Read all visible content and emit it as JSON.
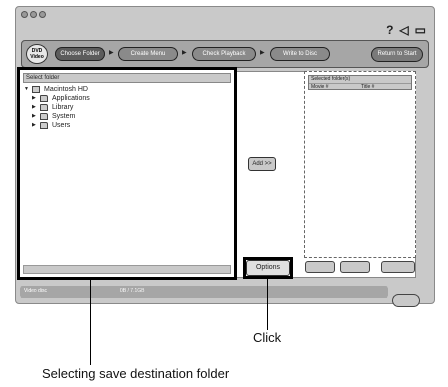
{
  "toolbar": {
    "logo_top": "DVD",
    "logo_bottom": "Video",
    "steps": [
      "Choose Folder",
      "Create Menu",
      "Check Playback",
      "Write to Disc"
    ],
    "return_label": "Return to Start"
  },
  "help_icon": "?",
  "folder_panel": {
    "header": "Select folder",
    "tree": [
      {
        "label": "Macintosh HD",
        "expanded": true,
        "icon": "disk-icon"
      },
      {
        "label": "Applications",
        "expanded": false,
        "icon": "folder-icon"
      },
      {
        "label": "Library",
        "expanded": false,
        "icon": "folder-icon"
      },
      {
        "label": "System",
        "expanded": false,
        "icon": "folder-icon"
      },
      {
        "label": "Users",
        "expanded": false,
        "icon": "folder-icon"
      }
    ]
  },
  "add_button": "Add >>",
  "selected_panel": {
    "header": "Selected folder(s)",
    "col1": "Movie #",
    "col2": "Title #"
  },
  "options_button": "Options",
  "status_bar": {
    "left": "Video disc",
    "middle": "0B / 7.1GB"
  },
  "callouts": {
    "click": "Click",
    "selecting": "Selecting save destination folder"
  }
}
